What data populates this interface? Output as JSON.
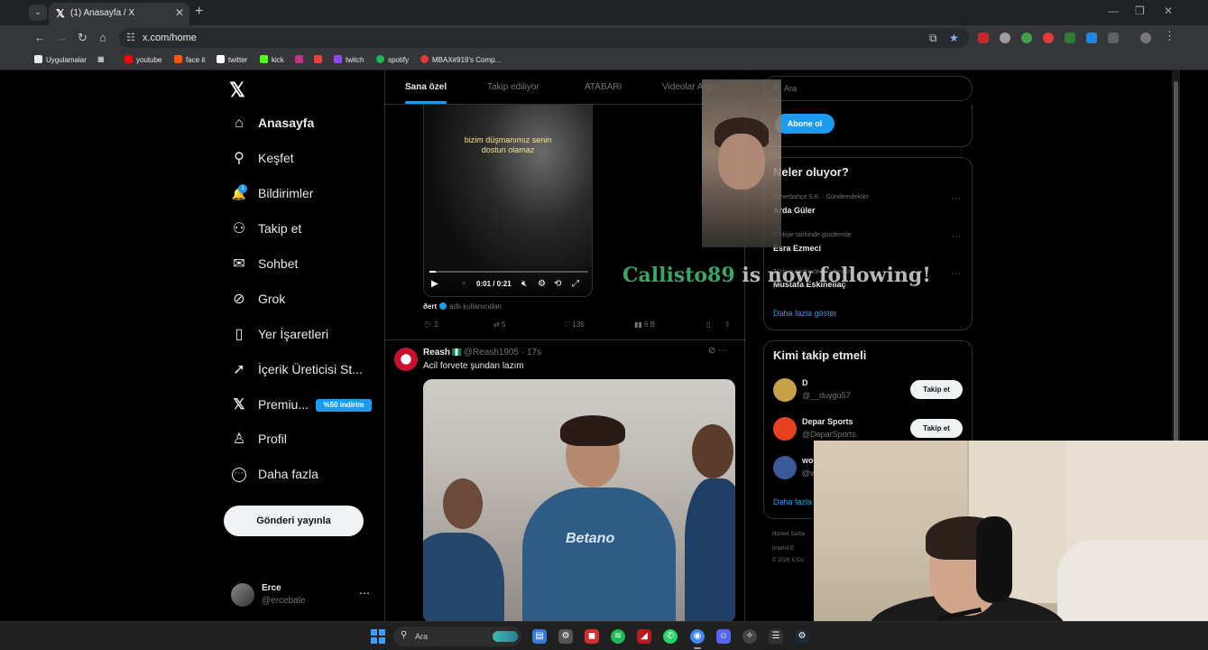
{
  "browser": {
    "tab_title": "(1) Anasayfa / X",
    "url": "x.com/home",
    "bookmarks": [
      {
        "label": "Uygulamalar",
        "color": "#e8eaed"
      },
      {
        "label": "youtube",
        "color": "#ff0000"
      },
      {
        "label": "face it",
        "color": "#ff5500"
      },
      {
        "label": "twitter",
        "color": "#ffffff"
      },
      {
        "label": "kick",
        "color": "#53fc18"
      },
      {
        "label": "",
        "color": "#c13584"
      },
      {
        "label": "",
        "color": "#ea4335"
      },
      {
        "label": "twitch",
        "color": "#9146ff"
      },
      {
        "label": "spotify",
        "color": "#1db954"
      },
      {
        "label": "MBAX#919's Comp...",
        "color": "#e53935"
      }
    ]
  },
  "sidebar": {
    "logo": "𝕏",
    "items": [
      {
        "label": "Anasayfa",
        "icon": "home-icon",
        "glyph": "⌂"
      },
      {
        "label": "Keşfet",
        "icon": "search-icon",
        "glyph": "⚲"
      },
      {
        "label": "Bildirimler",
        "icon": "bell-icon",
        "glyph": "🔔"
      },
      {
        "label": "Takip et",
        "icon": "add-person-icon",
        "glyph": "⚇"
      },
      {
        "label": "Sohbet",
        "icon": "mail-icon",
        "glyph": "✉"
      },
      {
        "label": "Grok",
        "icon": "grok-icon",
        "glyph": "⊘"
      },
      {
        "label": "Yer İşaretleri",
        "icon": "bookmark-icon",
        "glyph": "▯"
      },
      {
        "label": "İçerik Üreticisi St...",
        "icon": "rocket-icon",
        "glyph": "➚"
      },
      {
        "label": "Premiu...",
        "icon": "x-premium-icon",
        "glyph": "𝕏"
      },
      {
        "label": "Profil",
        "icon": "person-icon",
        "glyph": "♙"
      },
      {
        "label": "Daha fazla",
        "icon": "more-circle-icon",
        "glyph": "⋯"
      }
    ],
    "notif_count": "1",
    "premium_badge": "%50 indirim",
    "post_button": "Gönderi yayınla",
    "account_name": "Erce",
    "account_handle": "@ercebale"
  },
  "timeline": {
    "tabs": [
      "Sana özel",
      "Takip ediliyor",
      "ATABARI",
      "Videolar Arşivi"
    ],
    "tweet1": {
      "video_caption_line1": "bizim düşmanımız senin",
      "video_caption_line2": "dostun olamaz",
      "video_progress": 0.04,
      "time": "0:01 / 0:21",
      "author": "ðert",
      "source": "adlı kullanıcıdan",
      "replies": "2",
      "reposts": "5",
      "likes": "135",
      "views": "6 B"
    },
    "tweet2": {
      "name": "Reash",
      "handle": "@Reash1905",
      "time": "17s",
      "text": "Acil forvete şundan lazım",
      "jersey_text": "Betano"
    }
  },
  "right": {
    "search_placeholder": "Ara",
    "subscribe_button": "Abone ol",
    "trends_title": "Neler oluyor?",
    "trends": [
      {
        "context": "Fenerbahçe S.K. · Gündemdekiler",
        "name": "Arda Güler"
      },
      {
        "context": "Türkiye tarihinde gündemde",
        "name": "Esra Ezmeci"
      },
      {
        "context": "Türkiye tarihinde gündemde",
        "name": "Mustafa Eskihellaç"
      }
    ],
    "show_more": "Daha fazla göster",
    "wtf_title": "Kimi takip etmeli",
    "who_to_follow": [
      {
        "name": "D",
        "handle": "@__duygu57",
        "button": "Takip et",
        "color": "#c9a04a"
      },
      {
        "name": "Depar Sports",
        "handle": "@DeparSports",
        "button": "Takip et",
        "color": "#e8411f"
      },
      {
        "name": "wo",
        "handle": "@w",
        "button": "",
        "color": "#3b5998"
      }
    ],
    "show_more_2": "Daha fazla",
    "footer_1": "Hizmet Şartla",
    "footer_2": "İmprint   E",
    "footer_3": "© 2026 X Co"
  },
  "overlay": {
    "follower": "Callisto89",
    "message": " is now following!"
  },
  "taskbar": {
    "search_placeholder": "Ara"
  }
}
